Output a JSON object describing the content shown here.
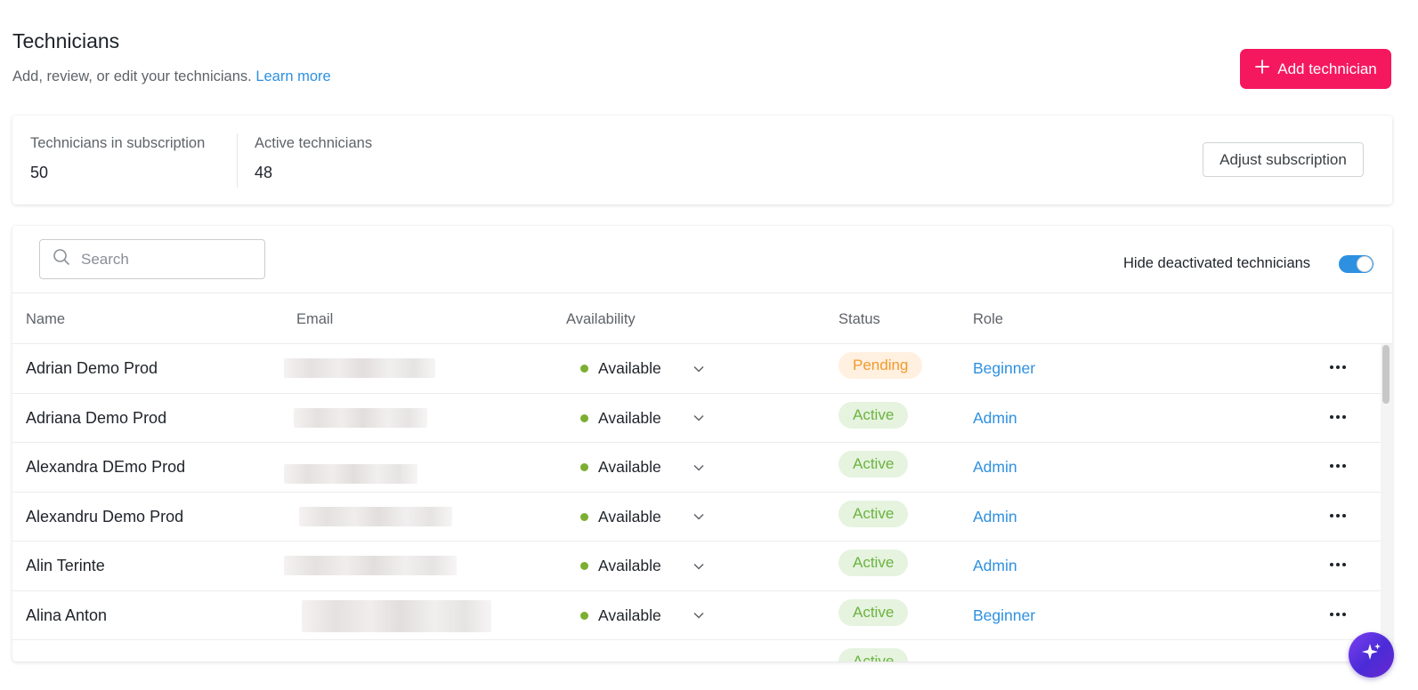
{
  "header": {
    "title": "Technicians",
    "subtitle": "Add, review, or edit your technicians.",
    "learn_more": "Learn more",
    "add_button": "Add technician"
  },
  "summary": {
    "subscription_label": "Technicians in subscription",
    "subscription_value": "50",
    "active_label": "Active technicians",
    "active_value": "48",
    "adjust_button": "Adjust subscription"
  },
  "toolbar": {
    "search_placeholder": "Search",
    "hide_deactivated_label": "Hide deactivated technicians",
    "hide_deactivated_on": true
  },
  "table": {
    "columns": [
      "Name",
      "Email",
      "Availability",
      "Status",
      "Role"
    ],
    "rows": [
      {
        "name": "Adrian Demo Prod",
        "availability": "Available",
        "status": "Pending",
        "role": "Beginner"
      },
      {
        "name": "Adriana Demo Prod",
        "availability": "Available",
        "status": "Active",
        "role": "Admin"
      },
      {
        "name": "Alexandra DEmo Prod",
        "availability": "Available",
        "status": "Active",
        "role": "Admin"
      },
      {
        "name": "Alexandru Demo Prod",
        "availability": "Available",
        "status": "Active",
        "role": "Admin"
      },
      {
        "name": "Alin Terinte",
        "availability": "Available",
        "status": "Active",
        "role": "Admin"
      },
      {
        "name": "Alina Anton",
        "availability": "Available",
        "status": "Active",
        "role": "Beginner"
      },
      {
        "name": "",
        "availability": "",
        "status": "Active",
        "role": ""
      }
    ]
  },
  "colors": {
    "accent_pink": "#f5185f",
    "link_blue": "#2e90e0",
    "available_green": "#7cae32",
    "pending_orange": "#f29a2e",
    "active_green": "#6cb33f"
  },
  "icons": {
    "search": "search-icon",
    "plus": "plus-icon",
    "chevron": "chevron-down-icon",
    "more": "more-horizontal-icon",
    "assistant": "sparkle-icon"
  }
}
